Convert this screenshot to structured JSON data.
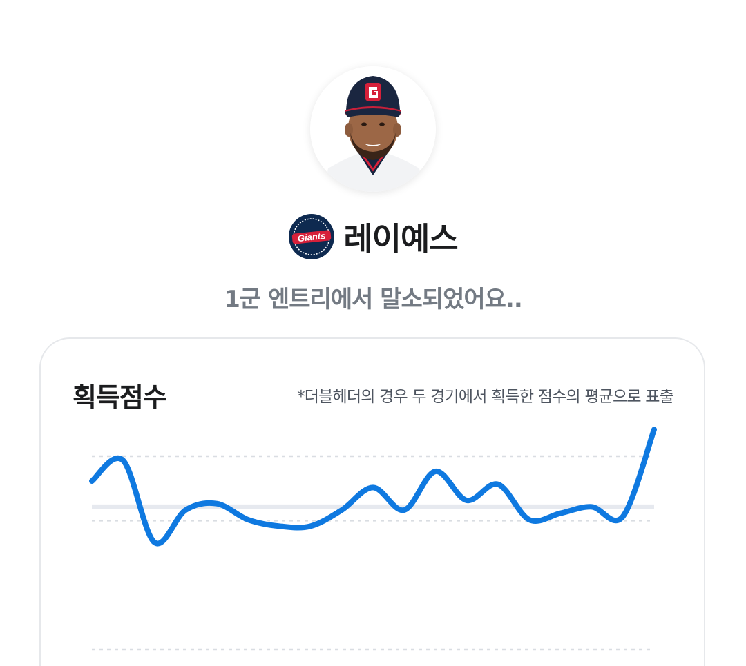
{
  "player": {
    "name": "레이예스",
    "avatar_icon": "player-photo-icon",
    "team_logo_icon": "giants-logo-icon",
    "team_logo_text": "Giants",
    "status": "1군 엔트리에서 말소되었어요.."
  },
  "score_card": {
    "title": "획득점수",
    "note": "*더블헤더의 경우 두 경기에서 획득한 점수의 평균으로 표출"
  },
  "colors": {
    "line": "#0f79e0",
    "baseline": "#e6e9ef",
    "grid": "#d9dde2",
    "team_navy": "#0e2a50",
    "team_red": "#d6203a"
  },
  "chart_data": {
    "type": "line",
    "grid": "dashed horizontal",
    "series": [
      {
        "values": [
          0.4,
          0.72,
          -0.55,
          -0.05,
          0.05,
          -0.2,
          -0.3,
          -0.3,
          -0.05,
          0.3,
          -0.05,
          0.55,
          0.1,
          0.35,
          -0.2,
          -0.1,
          0.0,
          -0.15,
          1.2
        ]
      }
    ],
    "average_value": 0.0,
    "ylim": [
      -2.0,
      1.0
    ]
  }
}
